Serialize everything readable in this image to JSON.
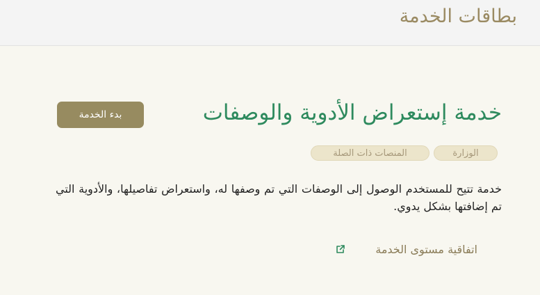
{
  "header": {
    "title": "بطاقات الخدمة"
  },
  "service": {
    "title": "خدمة إستعراض الأدوية والوصفات",
    "start_button_label": "بدء الخدمة",
    "tags": [
      "الوزارة",
      "المنصات ذات الصلة"
    ],
    "description": "خدمة تتيح للمستخدم الوصول إلى الوصفات التي تم وصفها له، واستعراض تفاصيلها، والأدوية التي تم إضافتها بشكل يدوي.",
    "sla_link_label": "اتفاقية مستوى الخدمة",
    "sla_icon": "external-link-icon"
  },
  "colors": {
    "title_green": "#2e8a5e",
    "accent_gold": "#978b60",
    "tag_bg": "#ece5cb",
    "page_bg": "#f8f7f0"
  }
}
